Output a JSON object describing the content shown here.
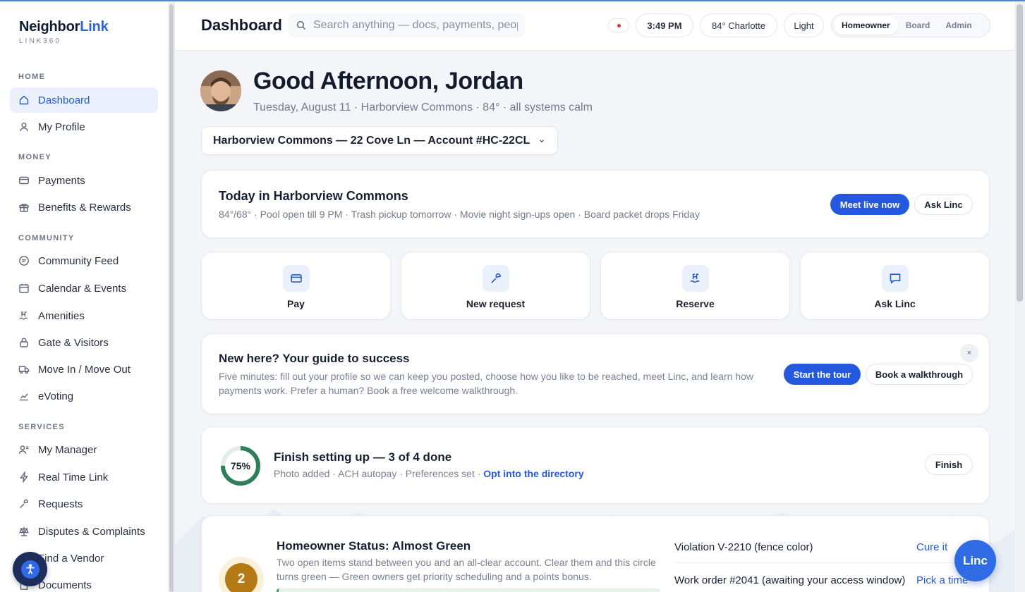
{
  "brand": {
    "name_part1": "Neighbor",
    "name_part2": "Link",
    "tagline": "LINK360"
  },
  "sidebar": {
    "sections": [
      {
        "label": "HOME",
        "items": [
          {
            "label": "Dashboard",
            "icon": "home-icon",
            "active": true
          },
          {
            "label": "My Profile",
            "icon": "user-icon"
          }
        ]
      },
      {
        "label": "MONEY",
        "items": [
          {
            "label": "Payments",
            "icon": "card-icon"
          },
          {
            "label": "Benefits & Rewards",
            "icon": "gift-icon"
          }
        ]
      },
      {
        "label": "COMMUNITY",
        "items": [
          {
            "label": "Community Feed",
            "icon": "feed-icon"
          },
          {
            "label": "Calendar & Events",
            "icon": "calendar-icon"
          },
          {
            "label": "Amenities",
            "icon": "pool-icon"
          },
          {
            "label": "Gate & Visitors",
            "icon": "lock-icon"
          },
          {
            "label": "Move In / Move Out",
            "icon": "truck-icon"
          },
          {
            "label": "eVoting",
            "icon": "ballot-icon"
          }
        ]
      },
      {
        "label": "SERVICES",
        "items": [
          {
            "label": "My Manager",
            "icon": "manager-icon"
          },
          {
            "label": "Real Time Link",
            "icon": "bolt-icon"
          },
          {
            "label": "Requests",
            "icon": "wrench-icon"
          },
          {
            "label": "Disputes & Complaints",
            "icon": "scale-icon"
          },
          {
            "label": "Find a Vendor",
            "icon": "vendor-icon"
          },
          {
            "label": "Documents",
            "icon": "document-icon"
          }
        ]
      }
    ]
  },
  "header": {
    "title": "Dashboard",
    "search_placeholder": "Search anything — docs, payments, people",
    "time": "3:49 PM",
    "weather": "84° Charlotte",
    "theme": "Light",
    "roles": [
      "Homeowner",
      "Board",
      "Admin"
    ],
    "active_role": "Homeowner"
  },
  "greeting": {
    "title": "Good Afternoon, Jordan",
    "subline": "Tuesday, August 11 · Harborview Commons · 84° · all systems calm"
  },
  "account": {
    "label": "Harborview Commons — 22 Cove Ln — Account #HC-22CL"
  },
  "today": {
    "title": "Today in Harborview Commons",
    "meta": "84°/68° · Pool open till 9 PM · Trash pickup tomorrow · Movie night sign-ups open · Board packet drops Friday",
    "primary_button": "Meet live now",
    "secondary_button": "Ask Linc"
  },
  "quick_actions": [
    {
      "label": "Pay",
      "icon": "card-icon"
    },
    {
      "label": "New request",
      "icon": "wrench-icon"
    },
    {
      "label": "Reserve",
      "icon": "pool-icon"
    },
    {
      "label": "Ask Linc",
      "icon": "chat-icon"
    }
  ],
  "guide": {
    "title": "New here? Your guide to success",
    "body": "Five minutes: fill out your profile so we can keep you posted, choose how you like to be reached, meet Linc, and learn how payments work. Prefer a human? Book a free welcome walkthrough.",
    "primary_button": "Start the tour",
    "secondary_button": "Book a walkthrough",
    "close": "×"
  },
  "setup": {
    "percent_label": "75%",
    "progress": 0.75,
    "title": "Finish setting up — 3 of 4 done",
    "meta": "Photo added · ACH autopay · Preferences set · ",
    "link": "Opt into the directory",
    "button": "Finish"
  },
  "status": {
    "badge": "2",
    "title": "Homeowner Status: Almost Green",
    "body": "Two open items stand between you and an all-clear account. Clear them and this circle turns green — Green owners get priority scheduling and a points bonus.",
    "items": [
      {
        "label": "Violation V-2210 (fence color)",
        "action": "Cure it"
      },
      {
        "label": "Work order #2041 (awaiting your access window)",
        "action": "Pick a time"
      }
    ]
  },
  "floating": {
    "linc_label": "Linc",
    "accessibility_icon": "accessibility-icon"
  },
  "colors": {
    "accent": "#2459df",
    "brand_dark": "#0f1a33",
    "status_amber": "#b37a16",
    "progress_green": "#2fa55a"
  }
}
